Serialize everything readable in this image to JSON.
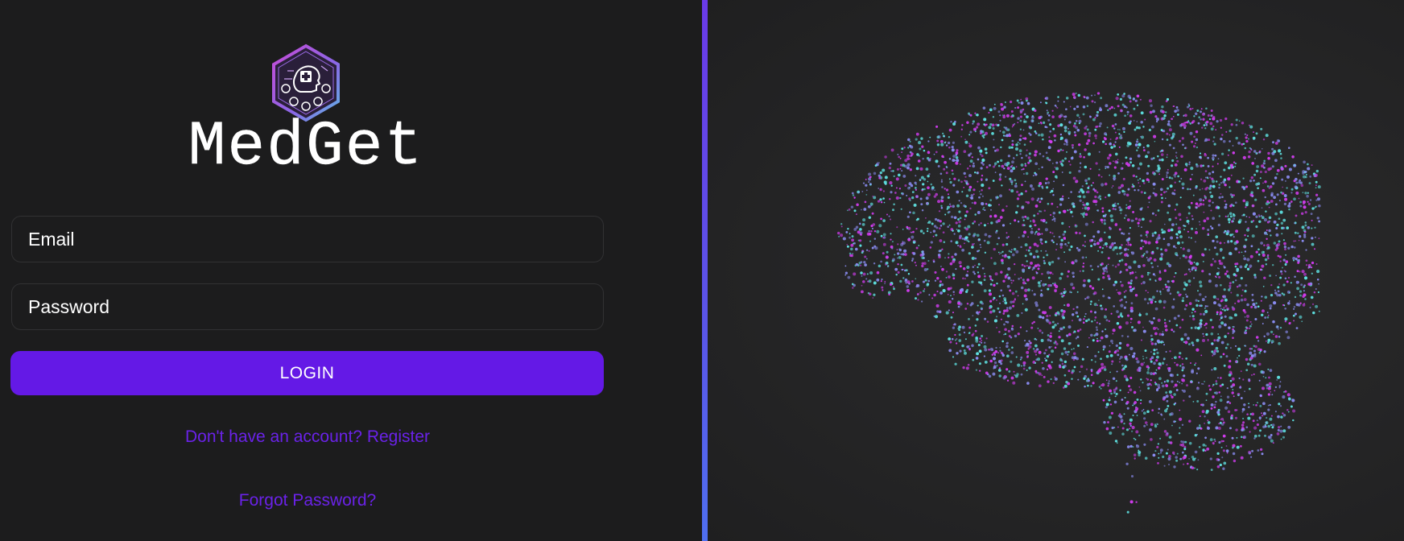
{
  "brand": {
    "name": "MedGet",
    "logo_icon": "medical-brain-hexagon-icon"
  },
  "form": {
    "email_placeholder": "Email",
    "password_placeholder": "Password",
    "login_label": "LOGIN",
    "register_link": "Don't have an account? Register",
    "forgot_link": "Forgot Password?"
  },
  "illustration": {
    "icon": "particle-brain-illustration",
    "colors": [
      "#d23cf0",
      "#5fe3e3",
      "#8a8cf2"
    ]
  },
  "theme": {
    "accent": "#6419e6",
    "link": "#6a22e8",
    "background": "#1c1c1d",
    "divider": "#5a55e8"
  }
}
